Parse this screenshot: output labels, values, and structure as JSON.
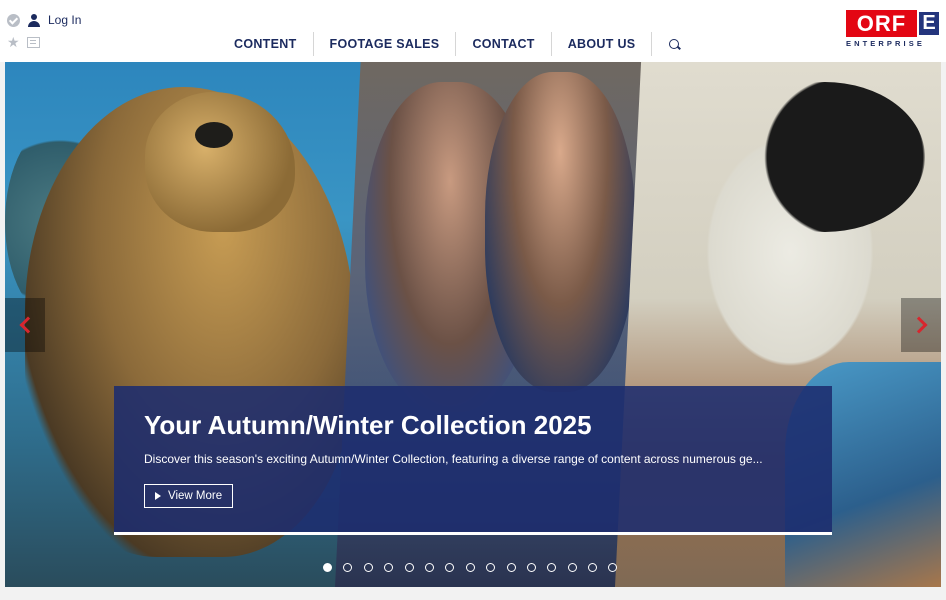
{
  "header": {
    "login_label": "Log In",
    "nav": [
      {
        "label": "CONTENT"
      },
      {
        "label": "FOOTAGE SALES"
      },
      {
        "label": "CONTACT"
      },
      {
        "label": "ABOUT US"
      }
    ],
    "icons": [
      "check-icon",
      "user-icon",
      "star-icon",
      "newspaper-icon",
      "search-icon"
    ]
  },
  "logo": {
    "main": "ORF",
    "badge": "E",
    "sub": "ENTERPRISE",
    "colors": {
      "red": "#e30613",
      "blue": "#24357d"
    }
  },
  "hero": {
    "title": "Your Autumn/Winter Collection 2025",
    "description": "Discover this season's exciting Autumn/Winter Collection, featuring a diverse range of content across numerous ge...",
    "button_label": "View More",
    "slide_count": 15,
    "active_slide": 1,
    "colors": {
      "caption_bg": "#1c2c6e",
      "arrow": "#d7262e"
    }
  }
}
